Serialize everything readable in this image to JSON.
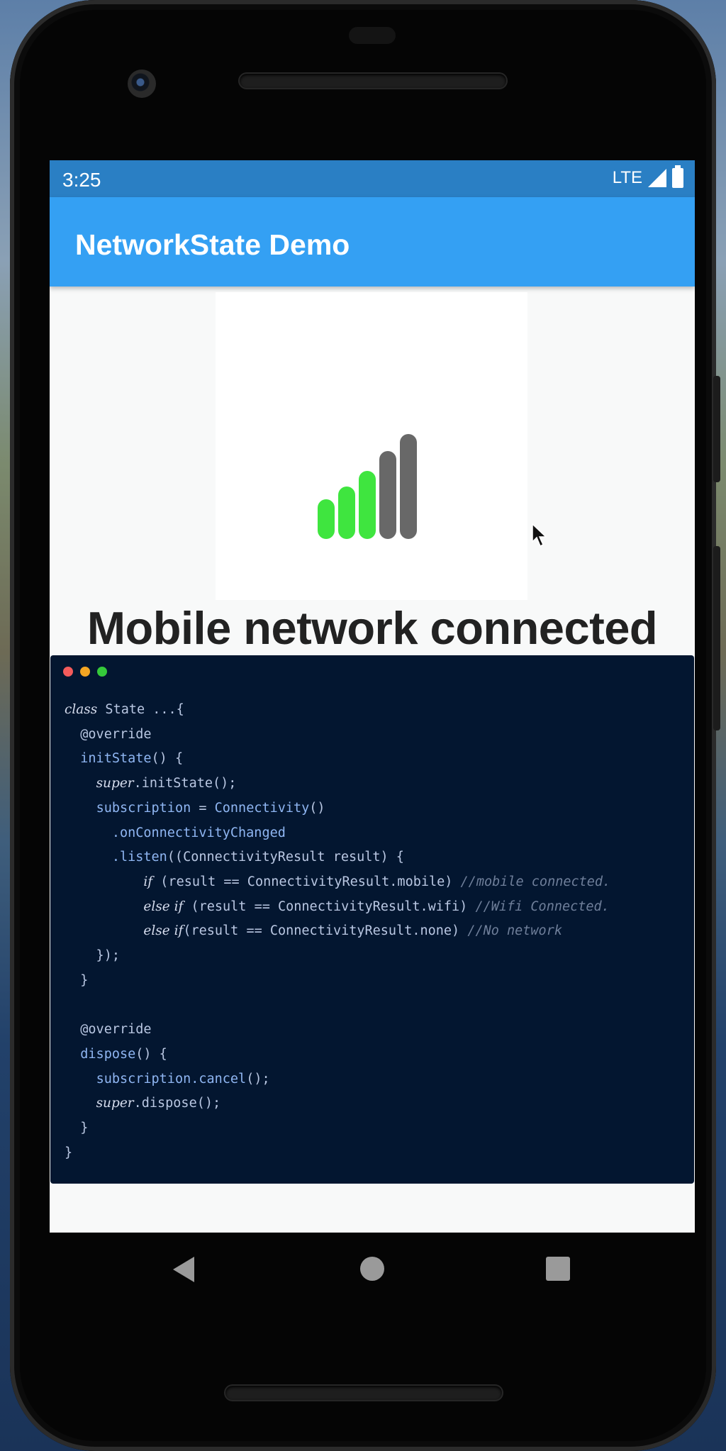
{
  "status_bar": {
    "time": "3:25",
    "network": "LTE"
  },
  "app_bar": {
    "title": "NetworkState Demo"
  },
  "network_status": {
    "text": "Mobile network connected",
    "signal_bars_active": 3,
    "signal_bars_total": 5
  },
  "colors": {
    "appbar": "#34a0f3",
    "statusbar": "#2a7fc4",
    "signal_active": "#3fe53f",
    "signal_inactive": "#686868",
    "code_bg": "#031630"
  },
  "code_window": {
    "dot_colors": [
      "#f45b5b",
      "#f5a623",
      "#35c93a"
    ],
    "lines": [
      [
        "kw:class",
        " State ...{"
      ],
      [
        "  @override"
      ],
      [
        "  ",
        "fn:initState",
        "() {"
      ],
      [
        "    ",
        "kw:super",
        ".initState();"
      ],
      [
        "    ",
        "fn:subscription",
        " = ",
        "fn:Connectivity",
        "()"
      ],
      [
        "      ",
        "fn:.onConnectivityChanged"
      ],
      [
        "      ",
        "fn:.listen",
        "((ConnectivityResult result) {"
      ],
      [
        "          ",
        "kw:if",
        " (result == ConnectivityResult.mobile) ",
        "cm://mobile connected."
      ],
      [
        "          ",
        "kw:else if",
        " (result == ConnectivityResult.wifi) ",
        "cm://Wifi Connected."
      ],
      [
        "          ",
        "kw:else if",
        "(result == ConnectivityResult.none) ",
        "cm://No network"
      ],
      [
        "    });"
      ],
      [
        "  }"
      ],
      [
        ""
      ],
      [
        "  @override"
      ],
      [
        "  ",
        "fn:dispose",
        "() {"
      ],
      [
        "    ",
        "fn:subscription.cancel",
        "();"
      ],
      [
        "    ",
        "kw:super",
        ".dispose();"
      ],
      [
        "  }"
      ],
      [
        "}"
      ]
    ]
  },
  "nav": {
    "back_icon": "back-triangle-icon",
    "home_icon": "home-circle-icon",
    "recents_icon": "recents-square-icon"
  }
}
